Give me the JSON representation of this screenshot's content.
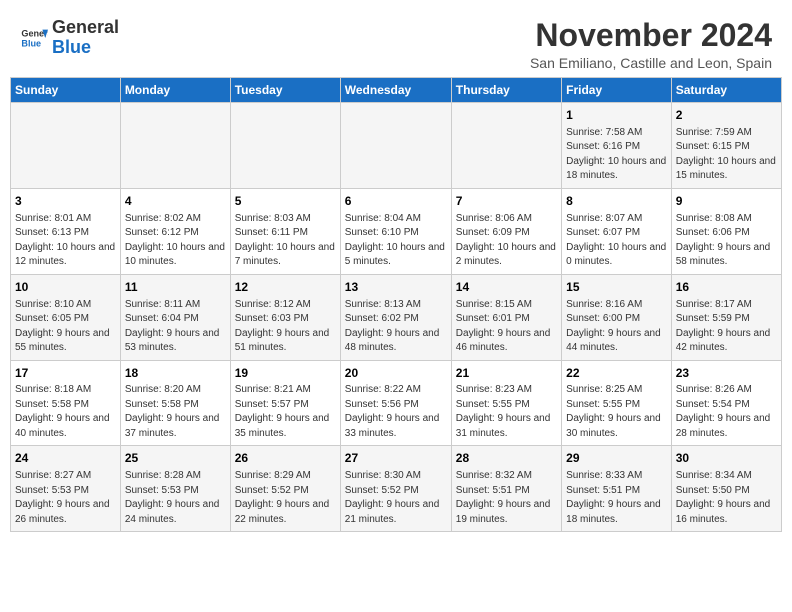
{
  "header": {
    "logo_general": "General",
    "logo_blue": "Blue",
    "month_title": "November 2024",
    "location": "San Emiliano, Castille and Leon, Spain"
  },
  "weekdays": [
    "Sunday",
    "Monday",
    "Tuesday",
    "Wednesday",
    "Thursday",
    "Friday",
    "Saturday"
  ],
  "weeks": [
    [
      {
        "day": "",
        "info": ""
      },
      {
        "day": "",
        "info": ""
      },
      {
        "day": "",
        "info": ""
      },
      {
        "day": "",
        "info": ""
      },
      {
        "day": "",
        "info": ""
      },
      {
        "day": "1",
        "info": "Sunrise: 7:58 AM\nSunset: 6:16 PM\nDaylight: 10 hours and 18 minutes."
      },
      {
        "day": "2",
        "info": "Sunrise: 7:59 AM\nSunset: 6:15 PM\nDaylight: 10 hours and 15 minutes."
      }
    ],
    [
      {
        "day": "3",
        "info": "Sunrise: 8:01 AM\nSunset: 6:13 PM\nDaylight: 10 hours and 12 minutes."
      },
      {
        "day": "4",
        "info": "Sunrise: 8:02 AM\nSunset: 6:12 PM\nDaylight: 10 hours and 10 minutes."
      },
      {
        "day": "5",
        "info": "Sunrise: 8:03 AM\nSunset: 6:11 PM\nDaylight: 10 hours and 7 minutes."
      },
      {
        "day": "6",
        "info": "Sunrise: 8:04 AM\nSunset: 6:10 PM\nDaylight: 10 hours and 5 minutes."
      },
      {
        "day": "7",
        "info": "Sunrise: 8:06 AM\nSunset: 6:09 PM\nDaylight: 10 hours and 2 minutes."
      },
      {
        "day": "8",
        "info": "Sunrise: 8:07 AM\nSunset: 6:07 PM\nDaylight: 10 hours and 0 minutes."
      },
      {
        "day": "9",
        "info": "Sunrise: 8:08 AM\nSunset: 6:06 PM\nDaylight: 9 hours and 58 minutes."
      }
    ],
    [
      {
        "day": "10",
        "info": "Sunrise: 8:10 AM\nSunset: 6:05 PM\nDaylight: 9 hours and 55 minutes."
      },
      {
        "day": "11",
        "info": "Sunrise: 8:11 AM\nSunset: 6:04 PM\nDaylight: 9 hours and 53 minutes."
      },
      {
        "day": "12",
        "info": "Sunrise: 8:12 AM\nSunset: 6:03 PM\nDaylight: 9 hours and 51 minutes."
      },
      {
        "day": "13",
        "info": "Sunrise: 8:13 AM\nSunset: 6:02 PM\nDaylight: 9 hours and 48 minutes."
      },
      {
        "day": "14",
        "info": "Sunrise: 8:15 AM\nSunset: 6:01 PM\nDaylight: 9 hours and 46 minutes."
      },
      {
        "day": "15",
        "info": "Sunrise: 8:16 AM\nSunset: 6:00 PM\nDaylight: 9 hours and 44 minutes."
      },
      {
        "day": "16",
        "info": "Sunrise: 8:17 AM\nSunset: 5:59 PM\nDaylight: 9 hours and 42 minutes."
      }
    ],
    [
      {
        "day": "17",
        "info": "Sunrise: 8:18 AM\nSunset: 5:58 PM\nDaylight: 9 hours and 40 minutes."
      },
      {
        "day": "18",
        "info": "Sunrise: 8:20 AM\nSunset: 5:58 PM\nDaylight: 9 hours and 37 minutes."
      },
      {
        "day": "19",
        "info": "Sunrise: 8:21 AM\nSunset: 5:57 PM\nDaylight: 9 hours and 35 minutes."
      },
      {
        "day": "20",
        "info": "Sunrise: 8:22 AM\nSunset: 5:56 PM\nDaylight: 9 hours and 33 minutes."
      },
      {
        "day": "21",
        "info": "Sunrise: 8:23 AM\nSunset: 5:55 PM\nDaylight: 9 hours and 31 minutes."
      },
      {
        "day": "22",
        "info": "Sunrise: 8:25 AM\nSunset: 5:55 PM\nDaylight: 9 hours and 30 minutes."
      },
      {
        "day": "23",
        "info": "Sunrise: 8:26 AM\nSunset: 5:54 PM\nDaylight: 9 hours and 28 minutes."
      }
    ],
    [
      {
        "day": "24",
        "info": "Sunrise: 8:27 AM\nSunset: 5:53 PM\nDaylight: 9 hours and 26 minutes."
      },
      {
        "day": "25",
        "info": "Sunrise: 8:28 AM\nSunset: 5:53 PM\nDaylight: 9 hours and 24 minutes."
      },
      {
        "day": "26",
        "info": "Sunrise: 8:29 AM\nSunset: 5:52 PM\nDaylight: 9 hours and 22 minutes."
      },
      {
        "day": "27",
        "info": "Sunrise: 8:30 AM\nSunset: 5:52 PM\nDaylight: 9 hours and 21 minutes."
      },
      {
        "day": "28",
        "info": "Sunrise: 8:32 AM\nSunset: 5:51 PM\nDaylight: 9 hours and 19 minutes."
      },
      {
        "day": "29",
        "info": "Sunrise: 8:33 AM\nSunset: 5:51 PM\nDaylight: 9 hours and 18 minutes."
      },
      {
        "day": "30",
        "info": "Sunrise: 8:34 AM\nSunset: 5:50 PM\nDaylight: 9 hours and 16 minutes."
      }
    ]
  ]
}
